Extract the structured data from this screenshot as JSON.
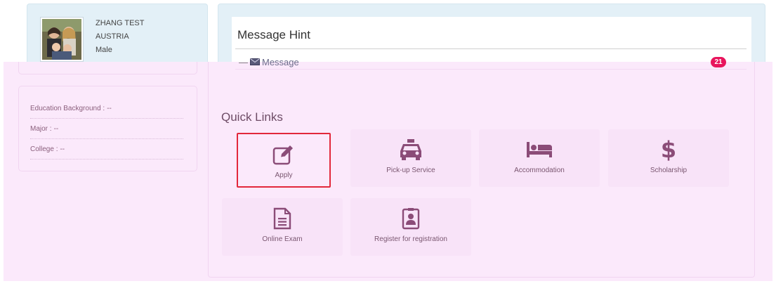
{
  "profile": {
    "name": "ZHANG TEST",
    "country": "AUSTRIA",
    "gender": "Male"
  },
  "education": [
    {
      "label": "Education Background :",
      "value": "--"
    },
    {
      "label": "Major :",
      "value": "--"
    },
    {
      "label": "College :",
      "value": "--"
    }
  ],
  "message_hint": {
    "title": "Message Hint",
    "link_label": "Message",
    "count": "21"
  },
  "quick_links": {
    "title": "Quick Links",
    "items": [
      {
        "label": "Apply",
        "icon": "edit-icon",
        "selected": true
      },
      {
        "label": "Pick-up Service",
        "icon": "taxi-icon"
      },
      {
        "label": "Accommodation",
        "icon": "bed-icon"
      },
      {
        "label": "Scholarship",
        "icon": "dollar-icon"
      },
      {
        "label": "Online Exam",
        "icon": "document-icon"
      },
      {
        "label": "Register for registration",
        "icon": "id-card-icon"
      }
    ]
  },
  "colors": {
    "accent_text": "#7a5670",
    "badge": "#e8155d",
    "selection_border": "#e2283b",
    "icon": "#8b4c78",
    "overlay": "#fbe9fb"
  }
}
